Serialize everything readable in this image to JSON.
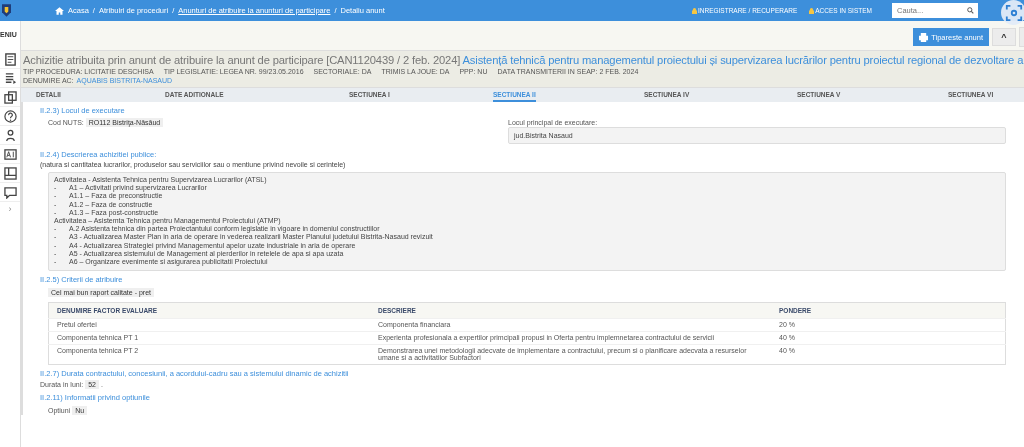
{
  "topbar": {
    "breadcrumb": [
      {
        "label": "Acasa",
        "link": false
      },
      {
        "label": "Atribuiri de proceduri",
        "link": false
      },
      {
        "label": "Anunturi de atribuire la anunturi de participare",
        "link": true
      },
      {
        "label": "Detaliu anunt",
        "link": false
      }
    ],
    "separator": "/",
    "links": [
      "INREGISTRARE / RECUPERARE",
      "ACCES IN SISTEM"
    ],
    "search": {
      "placeholder": "Cauta..."
    }
  },
  "sidebar": {
    "label": "ENIU",
    "expand": "›"
  },
  "header": {
    "print_button": "Tipareste anunt",
    "collapse_button": "^"
  },
  "notice": {
    "title": "Achizitie atribuita prin anunt de atribuire la anunt de participare [CAN1120439 / 2 feb. 2024]",
    "subject": "Asistență tehnică pentru managementul proiectului și supervizarea lucrărilor pentru proiectul regional de dezvoltare a",
    "meta": [
      {
        "label": "TIP PROCEDURA:",
        "value": "LICITATIE DESCHISA"
      },
      {
        "label": "TIP LEGISLATIE:",
        "value": "LEGEA NR. 99/23.05.2016"
      },
      {
        "label": "SECTORIALE:",
        "value": "DA"
      },
      {
        "label": "TRIMIS LA JOUE:",
        "value": "DA"
      },
      {
        "label": "PPP:",
        "value": "NU"
      },
      {
        "label": "DATA TRANSMITERII IN SEAP:",
        "value": "2 FEB. 2024"
      }
    ],
    "authority": {
      "label": "DENUMIRE AC:",
      "value": "AQUABIS BISTRITA-NASAUD"
    }
  },
  "tabs": [
    {
      "label": "DETALII",
      "selected": false
    },
    {
      "label": "DATE ADITIONALE",
      "selected": false
    },
    {
      "label": "SECTIUNEA I",
      "selected": false
    },
    {
      "label": "SECTIUNEA II",
      "selected": true
    },
    {
      "label": "SECTIUNEA IV",
      "selected": false
    },
    {
      "label": "SECTIUNEA V",
      "selected": false
    },
    {
      "label": "SECTIUNEA VI",
      "selected": false
    }
  ],
  "place": {
    "heading": "II.2.3) Locul de executare",
    "nuts_label": "Cod NUTS:",
    "nuts_value": "RO112 Bistriţa-Năsăud",
    "main_label": "Locul principal de executare:",
    "main_value": "jud.Bistrita Nasaud"
  },
  "description": {
    "heading": "II.2.4) Descrierea achizitiei publice:",
    "note": "(natura si cantitatea lucrarilor, produselor sau serviciilor sau o mentiune privind nevoile si cerintele)",
    "lines": [
      {
        "kind": "heading",
        "text": "Activitatea - Asistenta Tehnica pentru Supervizarea Lucrarilor (ATSL)"
      },
      {
        "kind": "item",
        "bullet": "-",
        "text": "A1 – Activitati privind supervizarea Lucrarilor"
      },
      {
        "kind": "item",
        "bullet": "-",
        "text": "A1.1 – Faza de preconstructie"
      },
      {
        "kind": "item",
        "bullet": "-",
        "text": "A1.2 – Faza de constructie"
      },
      {
        "kind": "item",
        "bullet": "-",
        "text": "A1.3 – Faza post-constructie"
      },
      {
        "kind": "heading",
        "text": "Activitatea – Asistemta Tehnica pentru Managementul Proiectului (ATMP)"
      },
      {
        "kind": "item",
        "bullet": "-",
        "text": "A.2   Asistenta tehnica din partea Proiectantului conform legislatie in vigoare in domeniul constructiilor"
      },
      {
        "kind": "item",
        "bullet": "-",
        "text": "A3 - Actualizarea Master Plan in aria de operare in vederea realizarii Master Planului judetului Bistrita-Nasaud revizuit"
      },
      {
        "kind": "item",
        "bullet": "-",
        "text": "A4 - Actualizarea Strategiei privind Managementul apelor uzate industriale in aria de operare"
      },
      {
        "kind": "item",
        "bullet": "-",
        "text": "A5 - Actualizarea sistemului de Management al pierderilor in retelele de apa si apa uzata"
      },
      {
        "kind": "item",
        "bullet": "-",
        "text": "A6 – Organizare evenimente si asigurarea publicitatii Proiectului"
      }
    ]
  },
  "criteria": {
    "heading": "II.2.5) Criterii de atribuire",
    "value": "Cel mai bun raport calitate - pret",
    "columns": [
      "DENUMIRE FACTOR EVALUARE",
      "DESCRIERE",
      "PONDERE"
    ],
    "rows": [
      [
        "Pretul ofertei",
        "Componenta financiara",
        "20 %"
      ],
      [
        "Componenta tehnica PT 1",
        "Experienta profesionala a expertilor primcipali propusi in Oferta pentru implemnetarea contractului de servicii",
        "40 %"
      ],
      [
        "Componenta tehnica PT 2",
        "Demonstrarea unei metodologii adecvate de implementare a contractului, precum si o planificare adecvata a resurselor umane si a activitatilor Subfactori",
        "40 %"
      ]
    ]
  },
  "duration": {
    "heading": "II.2.7) Durata contractului, concesiunii, a acordului-cadru sau a sistemului dinamic de achizitii",
    "label": "Durata in luni:",
    "value": "52",
    "suffix": "."
  },
  "options": {
    "heading": "II.2.11) Informatii privind optiunile",
    "label": "Optiuni",
    "value": "Nu"
  }
}
